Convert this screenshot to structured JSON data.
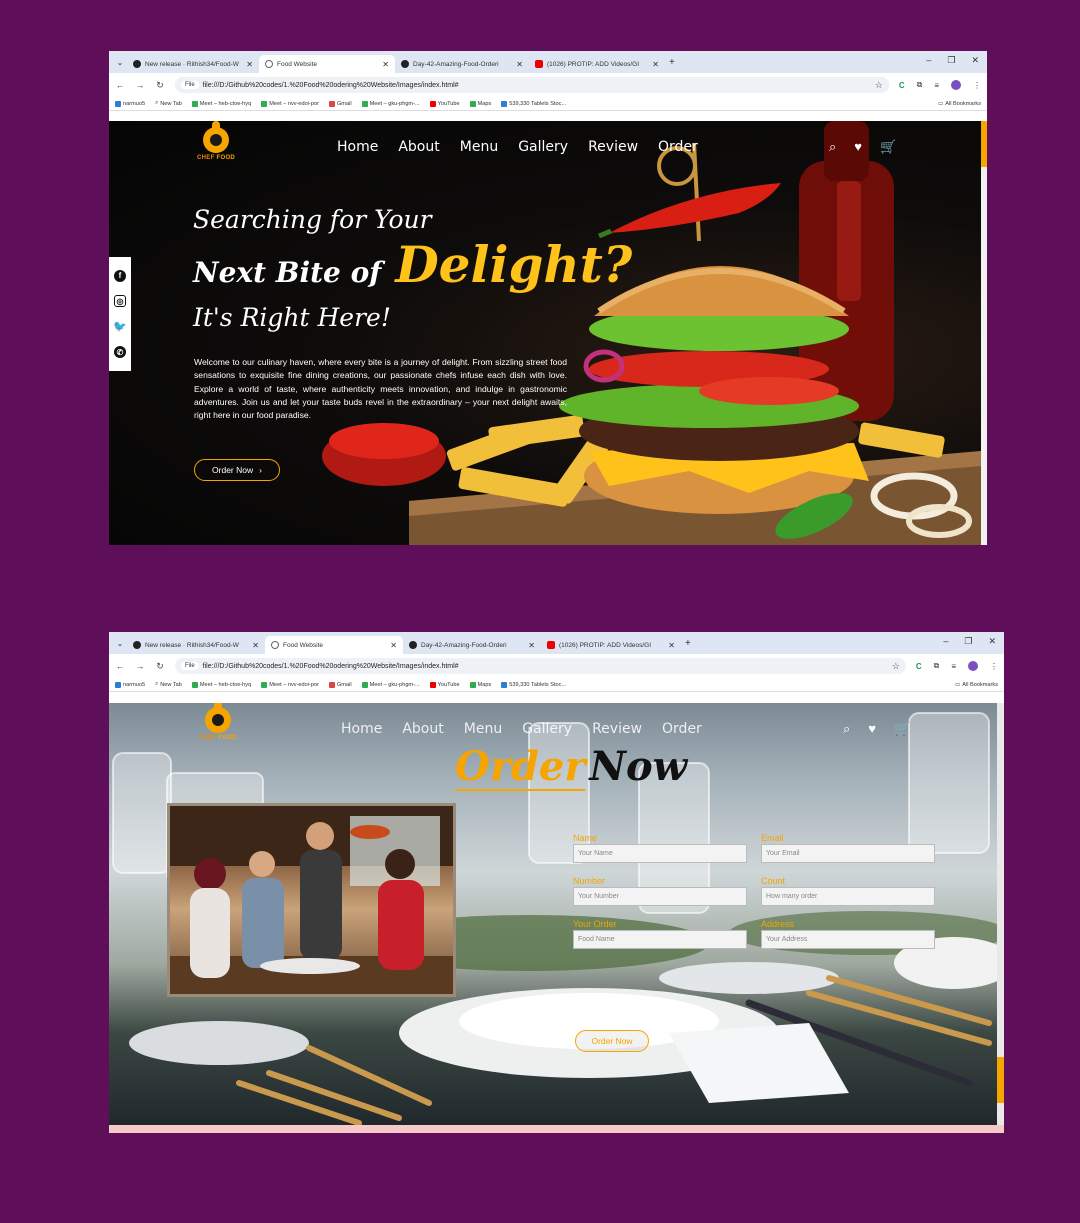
{
  "browser": {
    "tabs": [
      {
        "label": "New release · Rithish34/Food-W",
        "icon": "github-icon"
      },
      {
        "label": "Food Website",
        "icon": "page-icon",
        "active": true
      },
      {
        "label": "Day-42-Amazing-Food-Orderi",
        "icon": "github-icon"
      },
      {
        "label": "(1026) PROTIP: ADD Videos/GI",
        "icon": "youtube-icon"
      }
    ],
    "tabs2": [
      {
        "label": "New release · Rithish34/Food-W"
      },
      {
        "label": "Food Website"
      },
      {
        "label": "Day-42-Amazing-Food-Orderi"
      },
      {
        "label": "(1026) PROTIP: ADD Videos/GI"
      }
    ],
    "file_chip": "File",
    "url": "file:///D:/Github%20codes/1.%20Food%20odering%20Website/Images/index.html#",
    "bookmarks": [
      "narmuo5",
      "New Tab",
      "Meet – heb-ctoe-hyq",
      "Meet – nvv-edoi-por",
      "Gmail",
      "Meet – gku-phgm-...",
      "YouTube",
      "Maps",
      "539,330 Tablets Stoc..."
    ],
    "all_bookmarks": "All Bookmarks"
  },
  "site": {
    "logo_chef": "CHEF",
    "logo_food": "FOOD",
    "nav": [
      "Home",
      "About",
      "Menu",
      "Gallery",
      "Review",
      "Order"
    ]
  },
  "hero": {
    "line1": "Searching for Your",
    "line2a": "Next Bite of",
    "line2b": "Delight?",
    "line3": "It's Right Here!",
    "paragraph": "Welcome to our culinary haven, where every bite is a journey of delight. From sizzling street food sensations to exquisite fine dining creations, our passionate chefs infuse each dish with love. Explore a world of taste, where authenticity meets innovation, and indulge in gastronomic adventures. Join us and let your taste buds revel in the extraordinary – your next delight awaits, right here in our food paradise.",
    "button": "Order Now"
  },
  "order": {
    "title_a": "Order",
    "title_b": "Now",
    "fields": {
      "name_label": "Name",
      "name_placeholder": "Your Name",
      "email_label": "Email",
      "email_placeholder": "Your Email",
      "number_label": "Number",
      "number_placeholder": "Your Number",
      "count_label": "Count",
      "count_placeholder": "How many order",
      "order_label": "Your Order",
      "order_placeholder": "Food Name",
      "address_label": "Address",
      "address_placeholder": "Your Address"
    },
    "button": "Order Now"
  },
  "colors": {
    "page_bg": "#5f0e5a",
    "accent": "#f5a400"
  }
}
